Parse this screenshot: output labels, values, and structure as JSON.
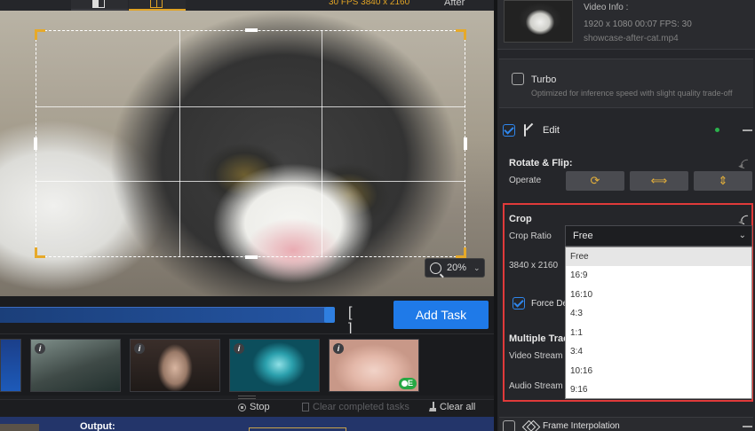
{
  "preview": {
    "fps_resolution": "30 FPS  3840 x 2160",
    "after_label": "After",
    "zoom_level": "20%"
  },
  "timeline": {
    "add_task_label": "Add Task"
  },
  "task_bar": {
    "stop_label": "Stop",
    "clear_completed_label": "Clear completed tasks",
    "clear_all_label": "Clear all"
  },
  "output": {
    "label": "Output:"
  },
  "thumbnails": {
    "info_glyph": "i",
    "badge_label": "E"
  },
  "video_info": {
    "heading": "Video Info :",
    "specs": "1920 x 1080  00:07    FPS: 30",
    "filename": "showcase-after-cat.mp4"
  },
  "turbo": {
    "label": "Turbo",
    "description": "Optimized for inference speed with slight quality trade-off"
  },
  "edit": {
    "label": "Edit"
  },
  "rotate_flip": {
    "title": "Rotate & Flip:",
    "operate_label": "Operate"
  },
  "crop": {
    "title": "Crop",
    "ratio_label": "Crop Ratio",
    "selected_ratio": "Free",
    "resolution": "3840 x 2160",
    "force_label": "Force De",
    "ratio_options": [
      "Free",
      "16:9",
      "16:10",
      "4:3",
      "1:1",
      "3:4",
      "10:16",
      "9:16"
    ]
  },
  "multiple_tracks": {
    "title": "Multiple Trac",
    "video_stream_label": "Video Stream",
    "audio_stream_label": "Audio Stream"
  },
  "frame_interpolation": {
    "label": "Frame Interpolation"
  },
  "colors": {
    "accent_blue": "#1f7ae8",
    "accent_orange": "#e0a325",
    "highlight_red": "#e03a3a"
  }
}
